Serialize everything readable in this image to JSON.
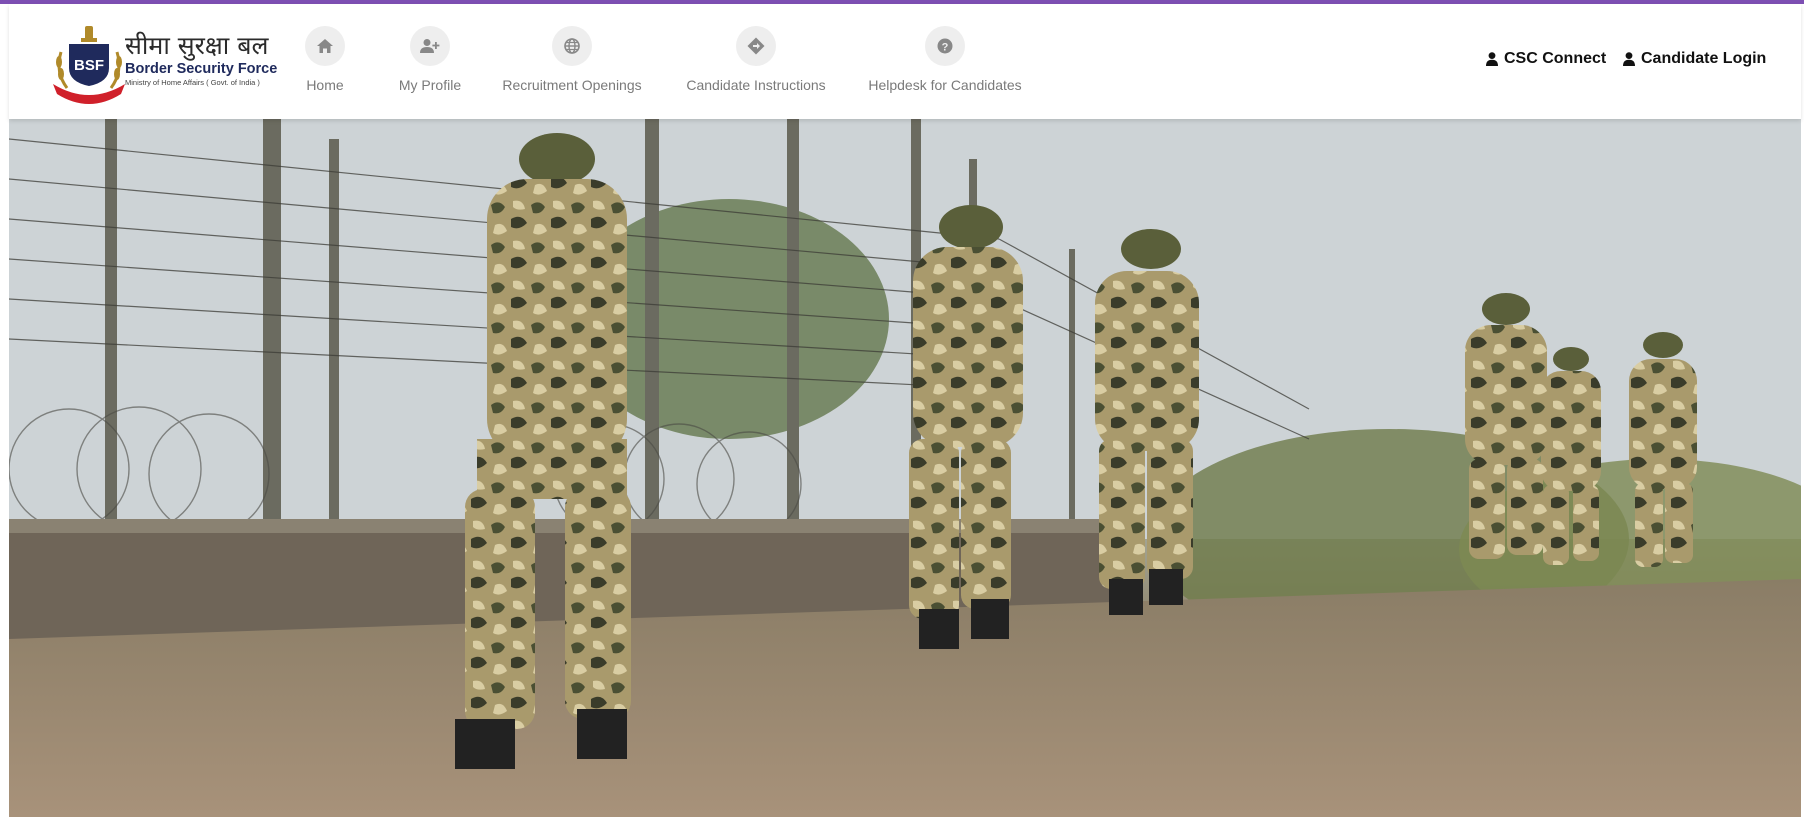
{
  "brand": {
    "emblem_text": "BSF",
    "hindi_name": "सीमा सुरक्षा बल",
    "english_name": "Border Security Force",
    "ministry": "Ministry of Home Affairs ( Govt. of India )"
  },
  "nav": {
    "items": [
      {
        "label": "Home",
        "icon": "home-icon"
      },
      {
        "label": "My Profile",
        "icon": "user-plus-icon"
      },
      {
        "label": "Recruitment Openings",
        "icon": "globe-icon"
      },
      {
        "label": "Candidate Instructions",
        "icon": "directions-sign-icon"
      },
      {
        "label": "Helpdesk for Candidates",
        "icon": "question-circle-icon"
      }
    ]
  },
  "auth": {
    "csc_label": "CSC Connect",
    "login_label": "Candidate Login",
    "icon": "user-icon"
  },
  "hero": {
    "image": "photo of BSF soldiers in camouflage uniforms patrolling along a barbed-wire border fence"
  },
  "colors": {
    "accent_bar": "#7d4fb3",
    "nav_icon_bg": "#eeeeee",
    "nav_text": "#7a7a7a",
    "brand_navy": "#1f2a5c",
    "brand_red": "#d0202a"
  }
}
